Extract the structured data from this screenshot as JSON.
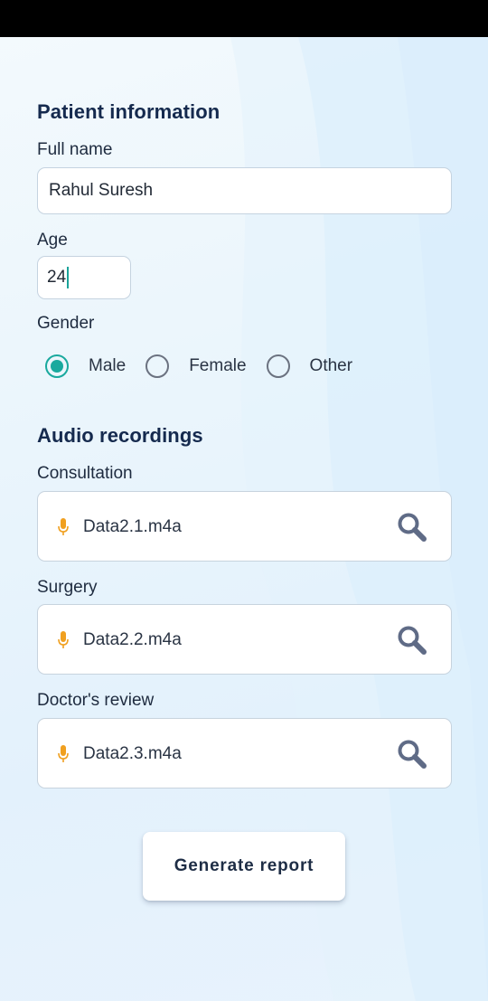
{
  "patient": {
    "section_title": "Patient information",
    "full_name_label": "Full name",
    "full_name_value": "Rahul Suresh",
    "age_label": "Age",
    "age_value": "24",
    "gender_label": "Gender",
    "gender_options": [
      {
        "label": "Male",
        "selected": true
      },
      {
        "label": "Female",
        "selected": false
      },
      {
        "label": "Other",
        "selected": false
      }
    ]
  },
  "audio": {
    "section_title": "Audio recordings",
    "recordings": [
      {
        "label": "Consultation",
        "file": "Data2.1.m4a"
      },
      {
        "label": "Surgery",
        "file": "Data2.2.m4a"
      },
      {
        "label": "Doctor's review",
        "file": "Data2.3.m4a"
      }
    ]
  },
  "actions": {
    "generate_label": "Generate report"
  },
  "colors": {
    "accent": "#19a99e",
    "heading": "#152a4e",
    "mic": "#f0a020",
    "search_icon": "#5f6b86"
  },
  "icons": {
    "mic": "microphone-icon",
    "search": "search-icon"
  }
}
